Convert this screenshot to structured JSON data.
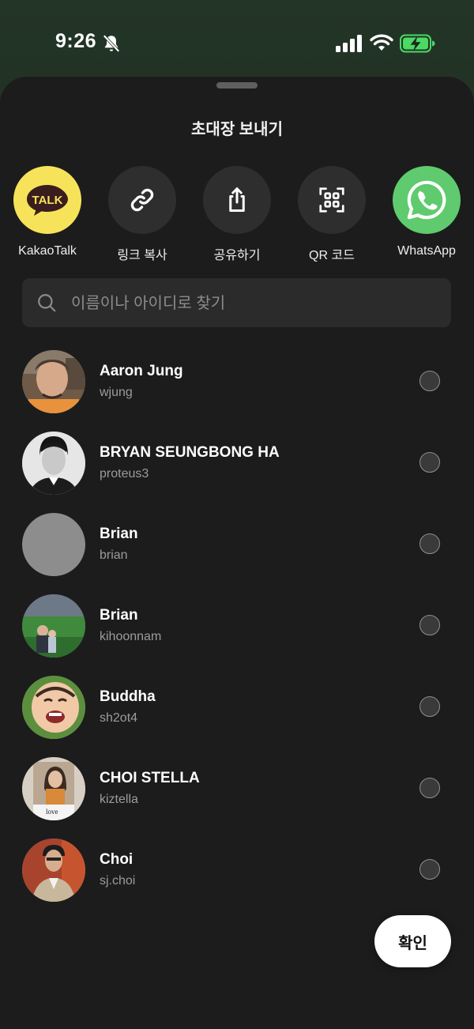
{
  "status_bar": {
    "time": "9:26",
    "icons": [
      "bell-off-icon",
      "signal-icon",
      "wifi-icon",
      "battery-charging-icon"
    ]
  },
  "sheet": {
    "title": "초대장 보내기"
  },
  "share_targets": [
    {
      "label": "KakaoTalk",
      "icon": "kakaotalk-icon",
      "brand_text": "TALK",
      "color": "#F7E35A"
    },
    {
      "label": "링크 복사",
      "icon": "link-icon",
      "color": "#2E2E2E"
    },
    {
      "label": "공유하기",
      "icon": "share-icon",
      "color": "#2E2E2E"
    },
    {
      "label": "QR 코드",
      "icon": "qr-code-icon",
      "color": "#2E2E2E"
    },
    {
      "label": "WhatsApp",
      "icon": "whatsapp-icon",
      "color": "#5FCB6E"
    }
  ],
  "search": {
    "placeholder": "이름이나 아이디로 찾기",
    "value": ""
  },
  "contacts": [
    {
      "name": "Aaron Jung",
      "handle": "wjung",
      "selected": false
    },
    {
      "name": "BRYAN SEUNGBONG HA",
      "handle": "proteus3",
      "selected": false
    },
    {
      "name": "Brian",
      "handle": "brian",
      "selected": false
    },
    {
      "name": "Brian",
      "handle": "kihoonnam",
      "selected": false
    },
    {
      "name": "Buddha",
      "handle": "sh2ot4",
      "selected": false
    },
    {
      "name": "CHOI STELLA",
      "handle": "kiztella",
      "selected": false,
      "photo_text": "love"
    },
    {
      "name": "Choi",
      "handle": "sj.choi",
      "selected": false
    }
  ],
  "actions": {
    "confirm_label": "확인"
  },
  "colors": {
    "sheet_background": "#1C1C1C",
    "kakao_yellow": "#F7E35A",
    "whatsapp_green": "#5FCB6E",
    "battery_green": "#4CD964"
  }
}
